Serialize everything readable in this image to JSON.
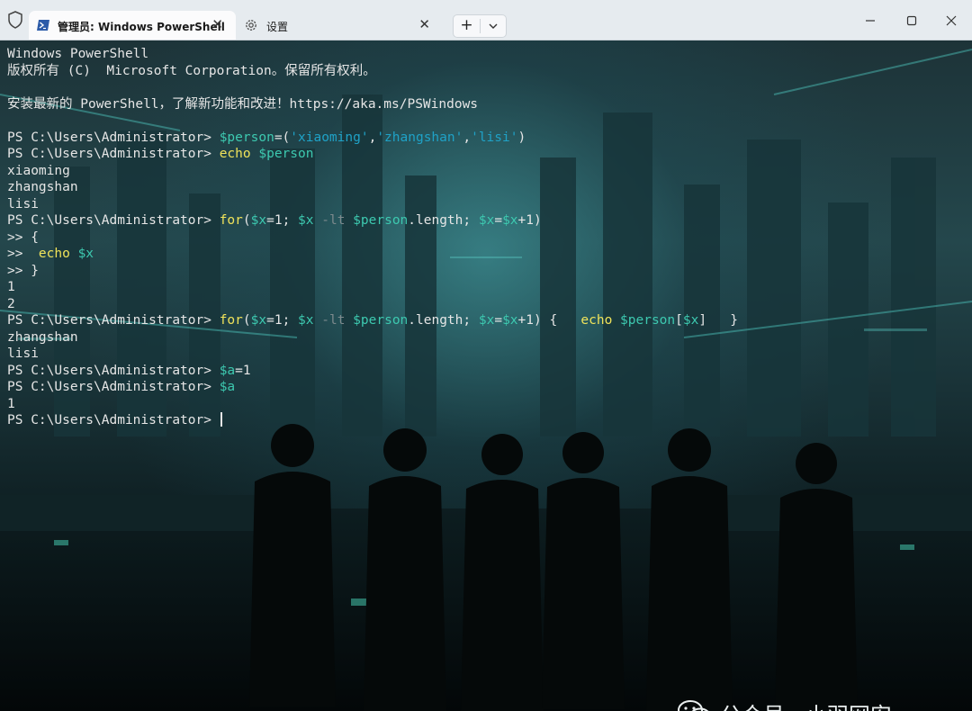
{
  "titlebar": {
    "tabs": [
      {
        "label": "管理员: Windows PowerShell",
        "active": true,
        "icon": "powershell-icon"
      },
      {
        "label": "设置",
        "active": false,
        "icon": "gear-icon"
      }
    ],
    "new_tab_label": "+",
    "close_glyph": "✕"
  },
  "terminal": {
    "lines": [
      [
        {
          "t": "Windows PowerShell",
          "c": ""
        }
      ],
      [
        {
          "t": "版权所有 (C)  Microsoft Corporation。保留所有权利。",
          "c": ""
        }
      ],
      [
        {
          "t": "",
          "c": ""
        }
      ],
      [
        {
          "t": "安装最新的 PowerShell，了解新功能和改进！https://aka.ms/PSWindows",
          "c": ""
        }
      ],
      [
        {
          "t": "",
          "c": ""
        }
      ],
      [
        {
          "t": "PS C:\\Users\\Administrator> ",
          "c": ""
        },
        {
          "t": "$person",
          "c": "v"
        },
        {
          "t": "=(",
          "c": ""
        },
        {
          "t": "'xiaoming'",
          "c": "s"
        },
        {
          "t": ",",
          "c": ""
        },
        {
          "t": "'zhangshan'",
          "c": "s"
        },
        {
          "t": ",",
          "c": ""
        },
        {
          "t": "'lisi'",
          "c": "s"
        },
        {
          "t": ")",
          "c": ""
        }
      ],
      [
        {
          "t": "PS C:\\Users\\Administrator> ",
          "c": ""
        },
        {
          "t": "echo",
          "c": "y"
        },
        {
          "t": " ",
          "c": ""
        },
        {
          "t": "$person",
          "c": "v"
        }
      ],
      [
        {
          "t": "xiaoming",
          "c": ""
        }
      ],
      [
        {
          "t": "zhangshan",
          "c": ""
        }
      ],
      [
        {
          "t": "lisi",
          "c": ""
        }
      ],
      [
        {
          "t": "PS C:\\Users\\Administrator> ",
          "c": ""
        },
        {
          "t": "for",
          "c": "y"
        },
        {
          "t": "(",
          "c": ""
        },
        {
          "t": "$x",
          "c": "v"
        },
        {
          "t": "=1; ",
          "c": ""
        },
        {
          "t": "$x",
          "c": "v"
        },
        {
          "t": " ",
          "c": ""
        },
        {
          "t": "-lt",
          "c": "d"
        },
        {
          "t": " ",
          "c": ""
        },
        {
          "t": "$person",
          "c": "v"
        },
        {
          "t": ".length; ",
          "c": ""
        },
        {
          "t": "$x",
          "c": "v"
        },
        {
          "t": "=",
          "c": ""
        },
        {
          "t": "$x",
          "c": "v"
        },
        {
          "t": "+1)",
          "c": ""
        }
      ],
      [
        {
          "t": ">> {",
          "c": ""
        }
      ],
      [
        {
          "t": ">>  ",
          "c": ""
        },
        {
          "t": "echo",
          "c": "y"
        },
        {
          "t": " ",
          "c": ""
        },
        {
          "t": "$x",
          "c": "v"
        }
      ],
      [
        {
          "t": ">> }",
          "c": ""
        }
      ],
      [
        {
          "t": "1",
          "c": ""
        }
      ],
      [
        {
          "t": "2",
          "c": ""
        }
      ],
      [
        {
          "t": "PS C:\\Users\\Administrator> ",
          "c": ""
        },
        {
          "t": "for",
          "c": "y"
        },
        {
          "t": "(",
          "c": ""
        },
        {
          "t": "$x",
          "c": "v"
        },
        {
          "t": "=1; ",
          "c": ""
        },
        {
          "t": "$x",
          "c": "v"
        },
        {
          "t": " ",
          "c": ""
        },
        {
          "t": "-lt",
          "c": "d"
        },
        {
          "t": " ",
          "c": ""
        },
        {
          "t": "$person",
          "c": "v"
        },
        {
          "t": ".length; ",
          "c": ""
        },
        {
          "t": "$x",
          "c": "v"
        },
        {
          "t": "=",
          "c": ""
        },
        {
          "t": "$x",
          "c": "v"
        },
        {
          "t": "+1) {   ",
          "c": ""
        },
        {
          "t": "echo",
          "c": "y"
        },
        {
          "t": " ",
          "c": ""
        },
        {
          "t": "$person",
          "c": "v"
        },
        {
          "t": "[",
          "c": ""
        },
        {
          "t": "$x",
          "c": "v"
        },
        {
          "t": "]   }",
          "c": ""
        }
      ],
      [
        {
          "t": "zhangshan",
          "c": ""
        }
      ],
      [
        {
          "t": "lisi",
          "c": ""
        }
      ],
      [
        {
          "t": "PS C:\\Users\\Administrator> ",
          "c": ""
        },
        {
          "t": "$a",
          "c": "v"
        },
        {
          "t": "=1",
          "c": ""
        }
      ],
      [
        {
          "t": "PS C:\\Users\\Administrator> ",
          "c": ""
        },
        {
          "t": "$a",
          "c": "v"
        }
      ],
      [
        {
          "t": "1",
          "c": ""
        }
      ],
      [
        {
          "t": "PS C:\\Users\\Administrator> ",
          "c": ""
        }
      ]
    ]
  },
  "watermark": {
    "text": "公众号 · 小羽网安",
    "icon": "wechat-icon"
  },
  "colors": {
    "command": "#f0e35a",
    "variable": "#3dc9b0",
    "string": "#1fa2c7",
    "operator": "#7d8a8d",
    "text": "#e6e6e6"
  }
}
